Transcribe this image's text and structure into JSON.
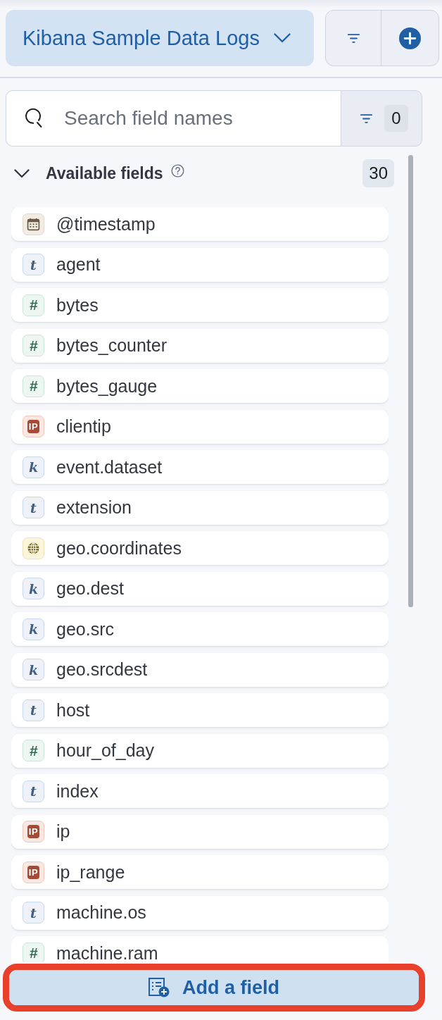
{
  "data_view": {
    "label": "Kibana Sample Data Logs"
  },
  "search": {
    "placeholder": "Search field names",
    "filter_count": "0"
  },
  "available_fields": {
    "title": "Available fields",
    "count": "30",
    "expanded": true,
    "fields": [
      {
        "name": "@timestamp",
        "kind": "date"
      },
      {
        "name": "agent",
        "kind": "text",
        "glyph": "t"
      },
      {
        "name": "bytes",
        "kind": "number",
        "glyph": "#"
      },
      {
        "name": "bytes_counter",
        "kind": "number",
        "glyph": "#"
      },
      {
        "name": "bytes_gauge",
        "kind": "number",
        "glyph": "#"
      },
      {
        "name": "clientip",
        "kind": "ip",
        "glyph": "IP"
      },
      {
        "name": "event.dataset",
        "kind": "keyword",
        "glyph": "k"
      },
      {
        "name": "extension",
        "kind": "text",
        "glyph": "t"
      },
      {
        "name": "geo.coordinates",
        "kind": "geo"
      },
      {
        "name": "geo.dest",
        "kind": "keyword",
        "glyph": "k"
      },
      {
        "name": "geo.src",
        "kind": "keyword",
        "glyph": "k"
      },
      {
        "name": "geo.srcdest",
        "kind": "keyword",
        "glyph": "k"
      },
      {
        "name": "host",
        "kind": "text",
        "glyph": "t"
      },
      {
        "name": "hour_of_day",
        "kind": "number",
        "glyph": "#"
      },
      {
        "name": "index",
        "kind": "text",
        "glyph": "t"
      },
      {
        "name": "ip",
        "kind": "ip",
        "glyph": "IP"
      },
      {
        "name": "ip_range",
        "kind": "ip",
        "glyph": "IP"
      },
      {
        "name": "machine.os",
        "kind": "text",
        "glyph": "t"
      },
      {
        "name": "machine.ram",
        "kind": "number",
        "glyph": "#"
      }
    ]
  },
  "add_field_button": {
    "label": "Add a field",
    "highlighted": true
  }
}
